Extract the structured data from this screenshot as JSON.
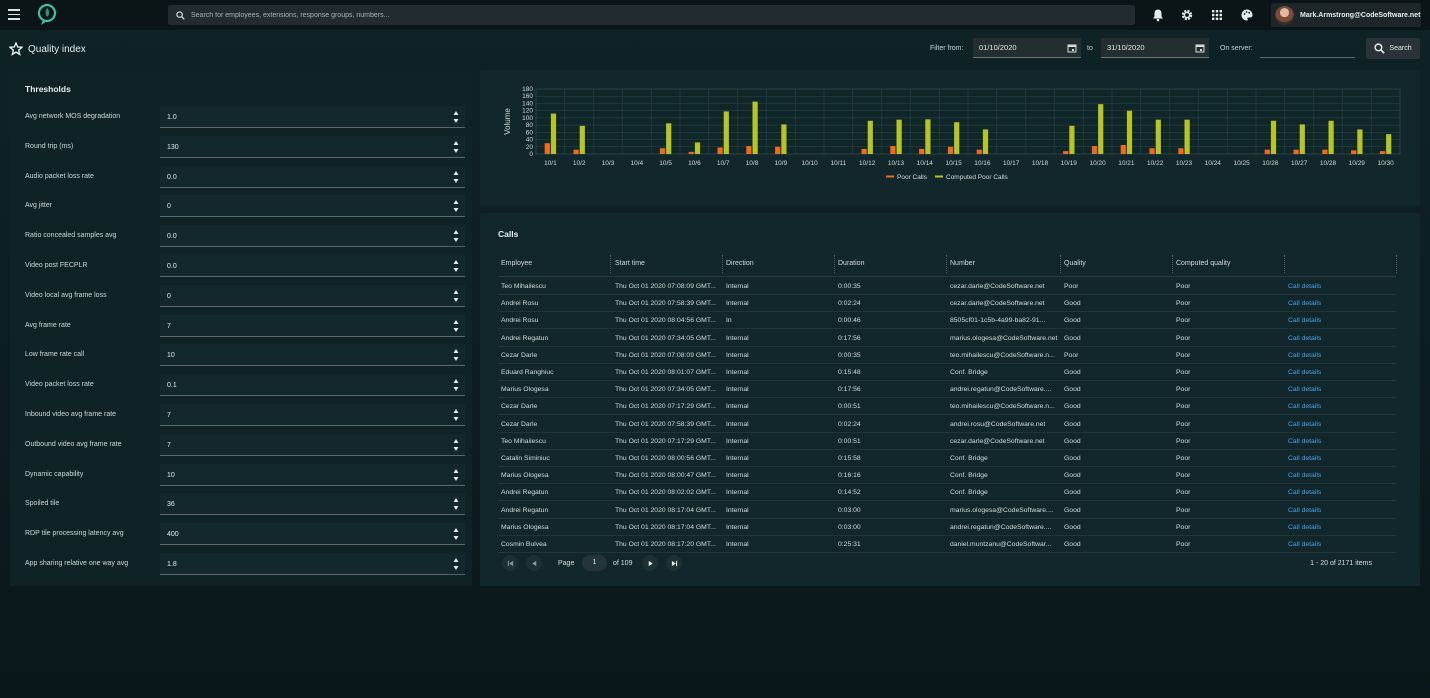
{
  "topbar": {
    "search_placeholder": "Search for employees, extensions, response groups, numbers...",
    "user": "Mark.Armstrong@CodeSoftware.net"
  },
  "header": {
    "title": "Quality index",
    "filter_from_label": "Filter from:",
    "from_date": "01/10/2020",
    "to_label": "to",
    "to_date": "31/10/2020",
    "server_label": "On server:",
    "search_label": "Search"
  },
  "thresholds": {
    "title": "Thresholds",
    "items": [
      {
        "label": "Avg network MOS degradation",
        "value": "1.0"
      },
      {
        "label": "Round trip (ms)",
        "value": "130"
      },
      {
        "label": "Audio packet loss rate",
        "value": "0.0"
      },
      {
        "label": "Avg jitter",
        "value": "0"
      },
      {
        "label": "Ratio concealed samples avg",
        "value": "0.0"
      },
      {
        "label": "Video post FECPLR",
        "value": "0.0"
      },
      {
        "label": "Video local avg frame loss",
        "value": "0"
      },
      {
        "label": "Avg frame rate",
        "value": "7"
      },
      {
        "label": "Low frame rate call",
        "value": "10"
      },
      {
        "label": "Video packet loss rate",
        "value": "0.1"
      },
      {
        "label": "Inbound video avg frame rate",
        "value": "7"
      },
      {
        "label": "Outbound video avg frame rate",
        "value": "7"
      },
      {
        "label": "Dynamic capability",
        "value": "10"
      },
      {
        "label": "Spoiled tile",
        "value": "36"
      },
      {
        "label": "RDP tile processing latency avg",
        "value": "400"
      },
      {
        "label": "App sharing relative one way avg",
        "value": "1.8"
      }
    ]
  },
  "chart_data": {
    "type": "bar",
    "ylabel": "Volume",
    "ylim": [
      0,
      180
    ],
    "yticks": [
      0,
      20,
      40,
      60,
      80,
      100,
      120,
      140,
      160,
      180
    ],
    "categories": [
      "10/1",
      "10/2",
      "10/3",
      "10/4",
      "10/5",
      "10/6",
      "10/7",
      "10/8",
      "10/9",
      "10/10",
      "10/11",
      "10/12",
      "10/13",
      "10/14",
      "10/15",
      "10/16",
      "10/17",
      "10/18",
      "10/19",
      "10/20",
      "10/21",
      "10/22",
      "10/23",
      "10/24",
      "10/25",
      "10/26",
      "10/27",
      "10/28",
      "10/29",
      "10/30"
    ],
    "series": [
      {
        "name": "Poor Calls",
        "color": "#f26a1b",
        "values": [
          30,
          12,
          0,
          0,
          16,
          6,
          18,
          22,
          20,
          0,
          0,
          14,
          22,
          14,
          20,
          12,
          0,
          0,
          8,
          22,
          25,
          16,
          16,
          0,
          0,
          12,
          12,
          12,
          10,
          8
        ]
      },
      {
        "name": "Computed Poor Calls",
        "color": "#b6c428",
        "values": [
          112,
          78,
          0,
          0,
          85,
          32,
          118,
          145,
          82,
          0,
          0,
          92,
          95,
          96,
          88,
          68,
          0,
          0,
          78,
          138,
          120,
          95,
          95,
          0,
          0,
          92,
          82,
          92,
          68,
          55
        ]
      }
    ],
    "legend": "bottom"
  },
  "calls": {
    "title": "Calls",
    "columns": [
      "Employee",
      "Start time",
      "Direction",
      "Duration",
      "Number",
      "Quality",
      "Computed quality"
    ],
    "link_label": "Call details",
    "rows": [
      [
        "Teo Mihailescu",
        "Thu Oct 01 2020 07:08:09 GMT...",
        "Internal",
        "0:00:35",
        "cezar.darle@CodeSoftware.net",
        "Poor",
        "Poor"
      ],
      [
        "Andrei Rosu",
        "Thu Oct 01 2020 07:58:39 GMT...",
        "Internal",
        "0:02:24",
        "cezar.darle@CodeSoftware.net",
        "Good",
        "Poor"
      ],
      [
        "Andrei Rosu",
        "Thu Oct 01 2020 08:04:56 GMT...",
        "In",
        "0:00:46",
        "8505cf01-1c5b-4a99-ba82-91...",
        "Good",
        "Poor"
      ],
      [
        "Andrei Regatun",
        "Thu Oct 01 2020 07:34:05 GMT...",
        "Internal",
        "0:17:56",
        "marius.ologesa@CodeSoftware.net",
        "Good",
        "Poor"
      ],
      [
        "Cezar Darle",
        "Thu Oct 01 2020 07:08:09 GMT...",
        "Internal",
        "0:00:35",
        "teo.mihailescu@CodeSoftware.n...",
        "Poor",
        "Poor"
      ],
      [
        "Eduard Ranghiuc",
        "Thu Oct 01 2020 08:01:07 GMT...",
        "Internal",
        "0:15:48",
        "Conf. Bridge",
        "Good",
        "Poor"
      ],
      [
        "Marius Ologesa",
        "Thu Oct 01 2020 07:34:05 GMT...",
        "Internal",
        "0:17:56",
        "andrei.regatun@CodeSoftware....",
        "Good",
        "Poor"
      ],
      [
        "Cezar Darle",
        "Thu Oct 01 2020 07:17:29 GMT...",
        "Internal",
        "0:00:51",
        "teo.mihailescu@CodeSoftware.n...",
        "Good",
        "Poor"
      ],
      [
        "Cezar Darle",
        "Thu Oct 01 2020 07:58:39 GMT...",
        "Internal",
        "0:02:24",
        "andrei.rosu@CodeSoftware.net",
        "Good",
        "Poor"
      ],
      [
        "Teo Mihailescu",
        "Thu Oct 01 2020 07:17:29 GMT...",
        "Internal",
        "0:00:51",
        "cezar.darle@CodeSoftware.net",
        "Good",
        "Poor"
      ],
      [
        "Catalin Siminiuc",
        "Thu Oct 01 2020 08:00:56 GMT...",
        "Internal",
        "0:15:58",
        "Conf. Bridge",
        "Good",
        "Poor"
      ],
      [
        "Marius Ologesa",
        "Thu Oct 01 2020 08:00:47 GMT...",
        "Internal",
        "0:16:16",
        "Conf. Bridge",
        "Good",
        "Poor"
      ],
      [
        "Andrei Regatun",
        "Thu Oct 01 2020 08:02:02 GMT...",
        "Internal",
        "0:14:52",
        "Conf. Bridge",
        "Good",
        "Poor"
      ],
      [
        "Andrei Regatun",
        "Thu Oct 01 2020 08:17:04 GMT...",
        "Internal",
        "0:03:00",
        "marius.ologesa@CodeSoftware....",
        "Good",
        "Poor"
      ],
      [
        "Marius Ologesa",
        "Thu Oct 01 2020 08:17:04 GMT...",
        "Internal",
        "0:03:00",
        "andrei.regatun@CodeSoftware....",
        "Good",
        "Poor"
      ],
      [
        "Cosmin Bulvea",
        "Thu Oct 01 2020 08:17:20 GMT...",
        "Internal",
        "0:25:31",
        "daniel.muntzanu@CodeSoftwar...",
        "Good",
        "Poor"
      ]
    ]
  },
  "pager": {
    "page_label": "Page",
    "current_page": "1",
    "of_label": "of 109",
    "items_label": "1 - 20 of 2171 items"
  }
}
